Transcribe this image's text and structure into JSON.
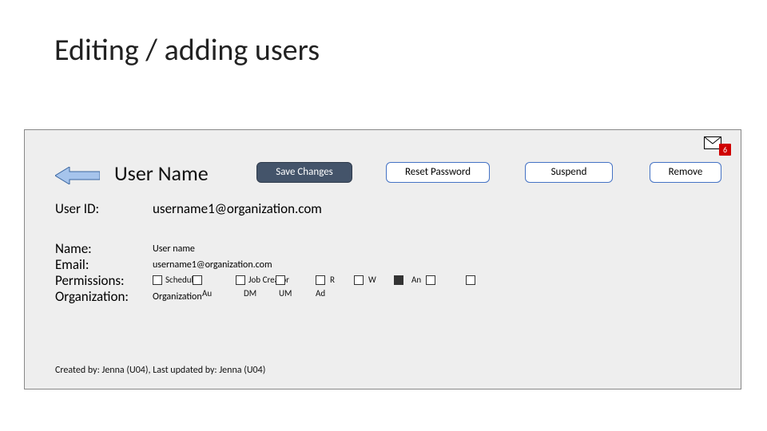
{
  "title": "Editing / adding users",
  "inbox_badge": "6",
  "heading": "User Name",
  "buttons": {
    "save": "Save Changes",
    "reset": "Reset Password",
    "suspend": "Suspend",
    "remove": "Remove"
  },
  "labels": {
    "user_id": "User ID:",
    "name": "Name:",
    "email": "Email:",
    "permissions": "Permissions:",
    "organization": "Organization:"
  },
  "values": {
    "user_id": "username1@organization.com",
    "name": "User name",
    "email": "username1@organization.com",
    "organization": "Organization"
  },
  "permissions": {
    "row1": [
      {
        "label": "Scheduler",
        "checked": false
      },
      {
        "label": "Job Creator",
        "checked": false
      },
      {
        "label": "R",
        "checked": false
      },
      {
        "label": "W",
        "checked": false
      },
      {
        "label": "An",
        "checked": true
      },
      {
        "label": "",
        "checked": false
      }
    ],
    "row2": [
      {
        "label": "Au"
      },
      {
        "label": "DM"
      },
      {
        "label": "UM"
      },
      {
        "label": "Ad"
      }
    ]
  },
  "footer": "Created by: Jenna (U04), Last updated by: Jenna (U04)"
}
